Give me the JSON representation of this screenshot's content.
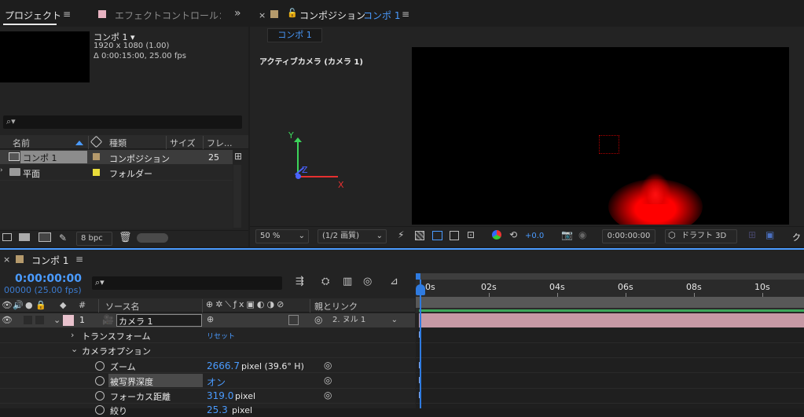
{
  "project": {
    "tab": "プロジェクト",
    "menu": "≡",
    "effect_tab": "エフェクトコントロール：",
    "more": "»",
    "comp_name": "コンポ 1 ▾",
    "size": "1920 x 1080 (1.00)",
    "duration": "Δ 0:00:15:00, 25.00 fps",
    "search_icon": "⌕▾",
    "headers": {
      "name": "名前",
      "kind": "種類",
      "size": "サイズ",
      "frame": "フレ..."
    },
    "items": [
      {
        "name": "コンポ 1",
        "kind": "コンポジション",
        "frame": "25",
        "color": "#b59a6c"
      },
      {
        "name": "平面",
        "kind": "フォルダー",
        "frame": "",
        "color": "#e8dc3a"
      }
    ],
    "bpc": "8 bpc"
  },
  "comp": {
    "tab_close": "×",
    "tab": "コンポジション",
    "tab_name": "コンポ 1",
    "menu": "≡",
    "sub_tab": "コンポ 1",
    "camera_label": "アクティブカメラ (カメラ 1)",
    "axis_x": "X",
    "axis_y": "Y",
    "axis_z": "Z",
    "zoom": "50 %",
    "resolution": "(1/2 画質)",
    "exposure": "+0.0",
    "timecode": "0:00:00:00",
    "draft": "ドラフト 3D",
    "truncated": "ク"
  },
  "timeline": {
    "close": "×",
    "tab": "コンポ 1",
    "menu": "≡",
    "time": "0:00:00:00",
    "frames": "00000 (25.00 fps)",
    "search_icon": "⌕▾",
    "col_num": "#",
    "col_source": "ソース名",
    "col_parent": "親とリンク",
    "ruler": [
      "0s",
      "02s",
      "04s",
      "06s",
      "08s",
      "10s"
    ],
    "layer": {
      "num": "1",
      "name": "カメラ 1",
      "parent": "2. ヌル 1"
    },
    "props": [
      {
        "name": "トランスフォーム",
        "value": "リセット",
        "arrow": "›"
      },
      {
        "name": "カメラオプション",
        "value": "",
        "arrow": "⌄"
      }
    ],
    "options": [
      {
        "name": "ズーム",
        "value": "2666.7",
        "unit": "pixel (39.6° H)"
      },
      {
        "name": "被写界深度",
        "value": "オン",
        "unit": ""
      },
      {
        "name": "フォーカス距離",
        "value": "319.0",
        "unit": "pixel"
      },
      {
        "name": "絞り",
        "value": "25.3",
        "unit": "pixel"
      }
    ]
  },
  "colors": {
    "accent": "#4a9bff",
    "layer_bar": "#d8a6b4",
    "camera_red": "#ff0000"
  }
}
